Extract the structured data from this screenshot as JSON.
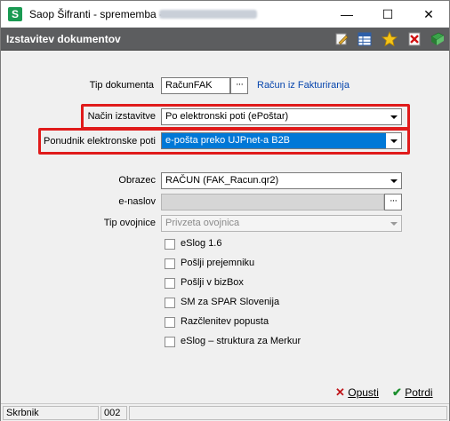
{
  "window": {
    "title": "Saop Šifranti - sprememba -",
    "app_icon_letter": "S",
    "minimize_glyph": "—",
    "maximize_glyph": "☐",
    "close_glyph": "✕"
  },
  "header": {
    "title": "Izstavitev dokumentov",
    "icons": [
      "edit-icon",
      "table-icon",
      "star-icon",
      "delete-icon",
      "book-icon"
    ]
  },
  "form": {
    "tip_dokumenta": {
      "label": "Tip dokumenta",
      "value": "RačunFAK",
      "button": "···",
      "link": "Račun iz Fakturiranja"
    },
    "nacin_izstavitve": {
      "label": "Način izstavitve",
      "value": "Po elektronski poti (ePoštar)"
    },
    "ponudnik": {
      "label": "Ponudnik elektronske poti",
      "value": "e-pošta preko UJPnet-a B2B"
    },
    "obrazec": {
      "label": "Obrazec",
      "value": "RAČUN (FAK_Racun.qr2)"
    },
    "e_naslov": {
      "label": "e-naslov",
      "value": "",
      "button": "···"
    },
    "tip_ovojnice": {
      "label": "Tip ovojnice",
      "value": "Privzeta ovojnica"
    }
  },
  "checkboxes": [
    {
      "label": "eSlog 1.6",
      "checked": false
    },
    {
      "label": "Pošlji prejemniku",
      "checked": false
    },
    {
      "label": "Pošlji v bizBox",
      "checked": false
    },
    {
      "label": "SM za SPAR Slovenija",
      "checked": false
    },
    {
      "label": "Razčlenitev popusta",
      "checked": false
    },
    {
      "label": "eSlog – struktura za Merkur",
      "checked": false
    }
  ],
  "footer": {
    "cancel_label": "Opusti",
    "confirm_label": "Potrdi"
  },
  "statusbar": {
    "user": "Skrbnik",
    "code": "002"
  },
  "colors": {
    "header_bg": "#5c5d5f",
    "highlight": "#e01b1b",
    "selection": "#0078d7",
    "link": "#0645ad"
  }
}
